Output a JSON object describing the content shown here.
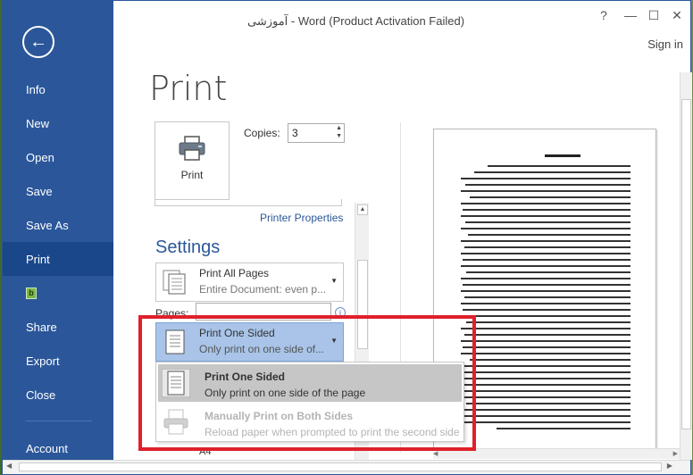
{
  "window": {
    "title": "آموزشی - Word (Product Activation Failed)",
    "help_glyph": "?",
    "minimize_glyph": "—",
    "maximize_glyph": "☐",
    "close_glyph": "✕",
    "sign_in": "Sign in"
  },
  "sidebar": {
    "back_glyph": "←",
    "items": [
      {
        "label": "Info"
      },
      {
        "label": "New"
      },
      {
        "label": "Open"
      },
      {
        "label": "Save"
      },
      {
        "label": "Save As"
      },
      {
        "label": "Print",
        "active": true
      },
      {
        "label": "",
        "icon": "green-document-icon"
      },
      {
        "label": "Share"
      },
      {
        "label": "Export"
      },
      {
        "label": "Close"
      },
      {
        "label": "Account"
      }
    ]
  },
  "main": {
    "page_title": "Print",
    "print_button_label": "Print",
    "copies_label": "Copies:",
    "copies_value": "3",
    "printer_properties": "Printer Properties",
    "settings_heading": "Settings",
    "print_pages": {
      "title": "Print All Pages",
      "subtitle": "Entire Document: even p..."
    },
    "pages_label": "Pages:",
    "info_glyph": "i",
    "sides": {
      "title": "Print One Sided",
      "subtitle": "Only print on one side of..."
    },
    "paper_size_partial": "A4"
  },
  "dropdown_options": [
    {
      "title": "Print One Sided",
      "subtitle": "Only print on one side of the page",
      "state": "highlighted"
    },
    {
      "title": "Manually Print on Both Sides",
      "subtitle": "Reload paper when prompted to print the second side",
      "state": "disabled"
    }
  ],
  "colors": {
    "accent": "#2b579a",
    "annotation": "#e0202a",
    "selected_dropdown": "#a9c4e8"
  }
}
